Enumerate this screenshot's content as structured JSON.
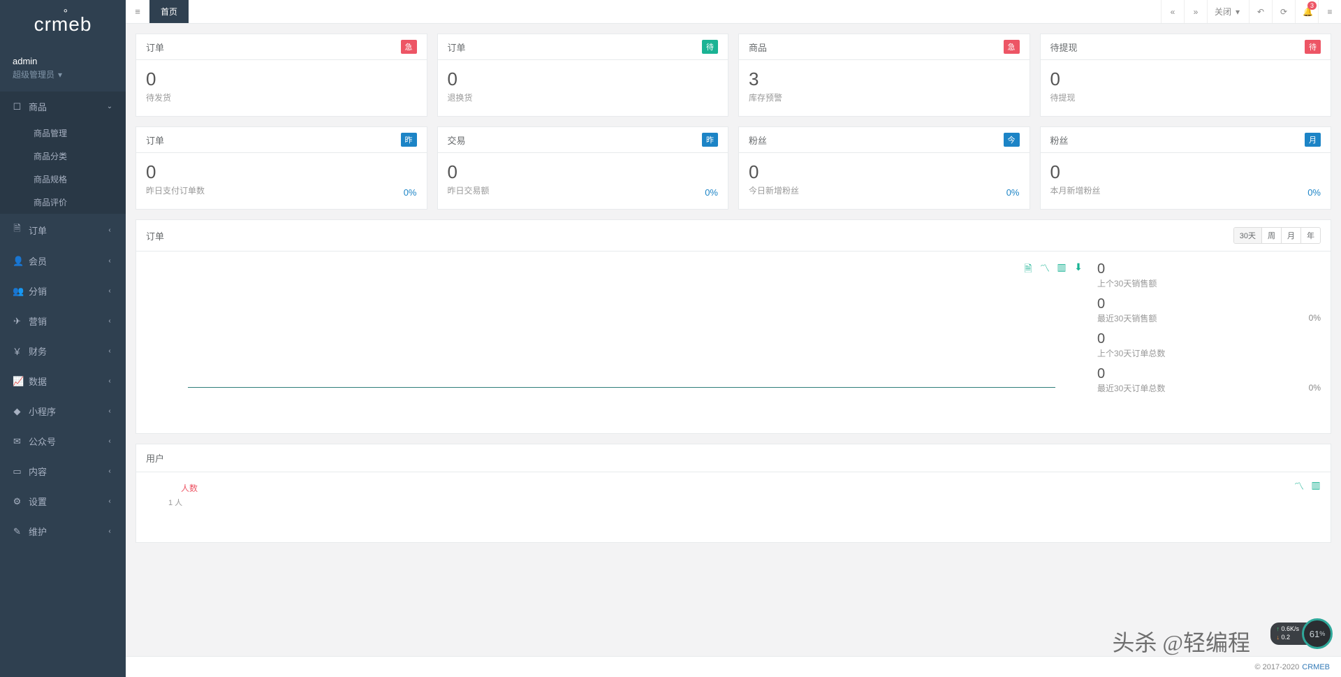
{
  "brand": "crmeb",
  "user": {
    "name": "admin",
    "role": "超级管理员"
  },
  "sidebar": {
    "items": [
      {
        "label": "商品",
        "icon": "laptop",
        "active": true,
        "children": [
          "商品管理",
          "商品分类",
          "商品规格",
          "商品评价"
        ]
      },
      {
        "label": "订单",
        "icon": "file"
      },
      {
        "label": "会员",
        "icon": "user"
      },
      {
        "label": "分销",
        "icon": "users"
      },
      {
        "label": "营销",
        "icon": "send"
      },
      {
        "label": "财务",
        "icon": "money"
      },
      {
        "label": "数据",
        "icon": "chart"
      },
      {
        "label": "小程序",
        "icon": "miniapp"
      },
      {
        "label": "公众号",
        "icon": "wechat"
      },
      {
        "label": "内容",
        "icon": "book"
      },
      {
        "label": "设置",
        "icon": "gear"
      },
      {
        "label": "维护",
        "icon": "wrench"
      }
    ]
  },
  "topbar": {
    "tab_home": "首页",
    "close_menu": "关闭",
    "notifications": "3"
  },
  "stats1": [
    {
      "title": "订单",
      "badge": "急",
      "badge_cls": "badge-red",
      "value": "0",
      "label": "待发货"
    },
    {
      "title": "订单",
      "badge": "待",
      "badge_cls": "badge-teal",
      "value": "0",
      "label": "退换货"
    },
    {
      "title": "商品",
      "badge": "急",
      "badge_cls": "badge-red",
      "value": "3",
      "label": "库存预警"
    },
    {
      "title": "待提现",
      "badge": "待",
      "badge_cls": "badge-red",
      "value": "0",
      "label": "待提现"
    }
  ],
  "stats2": [
    {
      "title": "订单",
      "badge": "昨",
      "badge_cls": "badge-blue",
      "value": "0",
      "label": "昨日支付订单数",
      "pct": "0%"
    },
    {
      "title": "交易",
      "badge": "昨",
      "badge_cls": "badge-blue",
      "value": "0",
      "label": "昨日交易额",
      "pct": "0%"
    },
    {
      "title": "粉丝",
      "badge": "今",
      "badge_cls": "badge-blue",
      "value": "0",
      "label": "今日新增粉丝",
      "pct": "0%"
    },
    {
      "title": "粉丝",
      "badge": "月",
      "badge_cls": "badge-blue",
      "value": "0",
      "label": "本月新增粉丝",
      "pct": "0%"
    }
  ],
  "order_panel": {
    "title": "订单",
    "time_ranges": [
      "30天",
      "周",
      "月",
      "年"
    ],
    "active_range": "30天",
    "side": [
      {
        "value": "0",
        "label": "上个30天销售额"
      },
      {
        "value": "0",
        "label": "最近30天销售额",
        "pct": "0%"
      },
      {
        "value": "0",
        "label": "上个30天订单总数"
      },
      {
        "value": "0",
        "label": "最近30天订单总数",
        "pct": "0%"
      }
    ]
  },
  "user_panel": {
    "title": "用户",
    "legend": "人数",
    "axis": "1 人"
  },
  "footer": {
    "copyright": "© 2017-2020",
    "link": "CRMEB"
  },
  "watermark": "头杀 @轻编程",
  "speed": {
    "up": "0.6K/s",
    "down": "0.2",
    "pct": "61",
    "unit": "%"
  },
  "chart_data": {
    "type": "line",
    "title": "订单",
    "series": [
      {
        "name": "最近30天",
        "values": [
          0
        ]
      }
    ],
    "ylim": [
      0,
      1
    ]
  },
  "icons": {
    "laptop": "☐",
    "file": "🗎",
    "user": "👤",
    "users": "👥",
    "send": "✈",
    "money": "￥",
    "chart": "📈",
    "miniapp": "◆",
    "wechat": "✉",
    "book": "▭",
    "gear": "⚙",
    "wrench": "✎"
  }
}
